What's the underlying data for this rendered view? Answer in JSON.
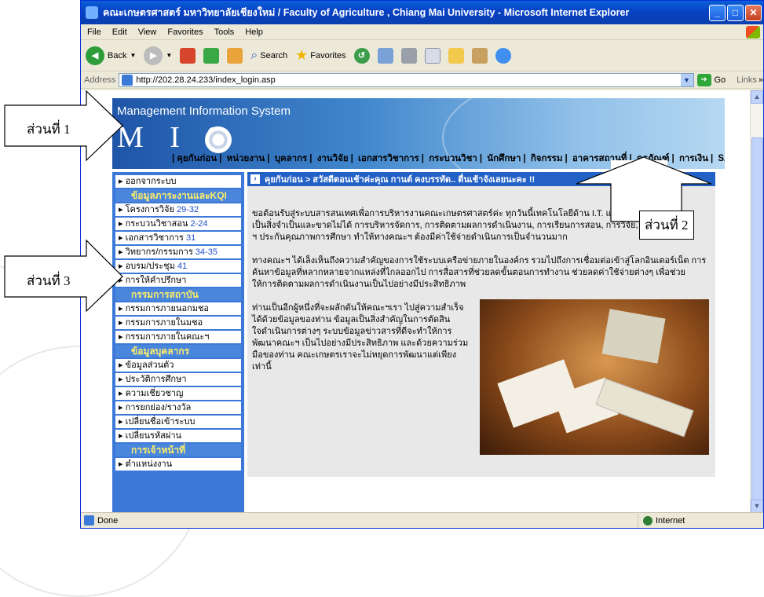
{
  "window": {
    "title": "คณะเกษตรศาสตร์ มหาวิทยาลัยเชียงใหม่ / Faculty of Agriculture , Chiang Mai University   - Microsoft Internet Explorer",
    "min_icon": "minimize-icon",
    "max_icon": "maximize-icon",
    "close_icon": "close-icon"
  },
  "menu": [
    "File",
    "Edit",
    "View",
    "Favorites",
    "Tools",
    "Help"
  ],
  "toolbar": {
    "back": "Back",
    "search": "Search",
    "favorites": "Favorites"
  },
  "address": {
    "label": "Address",
    "url": "http://202.28.24.233/index_login.asp",
    "go": "Go",
    "links": "Links"
  },
  "header": {
    "subtitle": "Management Information System",
    "logo": "M I S"
  },
  "topnav": [
    "คุยกันก่อน",
    "หน่วยงาน",
    "บุคลากร",
    "งานวิจัย",
    "เอกสารวิชาการ",
    "กระบวนวิชา",
    "นักศึกษา",
    "กิจกรรม",
    "อาคารสถานที่",
    "ครุภัณฑ์",
    "การเงิน",
    "SAR"
  ],
  "breadcrumb": "คุยกันก่อน > สวัสดีตอนเช้าค่ะคุณ กานต์ คงบรรทัด.. ตื่นเช้าจังเลยนะคะ !!",
  "sidebar": {
    "logout": "ออกจากระบบ",
    "section1": "ข้อมูลภาระงานและKQI",
    "items1": [
      {
        "label": "โครงการวิจัย",
        "num": "29-32"
      },
      {
        "label": "กระบวนวิชาสอน",
        "num": "2-24"
      },
      {
        "label": "เอกสารวิชาการ",
        "num": "31"
      },
      {
        "label": "วิทยากร/กรรมการ",
        "num": "34-35"
      },
      {
        "label": "อบรม/ประชุม",
        "num": "41"
      },
      {
        "label": "การให้คำปรึกษา",
        "num": ""
      }
    ],
    "section2": "กรรมการสถาบัน",
    "items2": [
      "กรรมการภายนอกมชอ",
      "กรรมการภายในมชอ",
      "กรรมการภายในคณะฯ"
    ],
    "section3": "ข้อมูลบุคลากร",
    "items3": [
      "ข้อมูลส่วนตัว",
      "ประวัติการศึกษา",
      "ความเชี่ยวชาญ",
      "การยกย่อง/รางวัล",
      "เปลี่ยนชื่อเข้าระบบ",
      "เปลี่ยนรหัสผ่าน"
    ],
    "section4": "การเจ้าหน้าที่",
    "items4": [
      "ตำแหน่งงาน"
    ]
  },
  "content": {
    "p1": "ขอต้อนรับสู่ระบบสารสนเทศเพื่อการบริหารงานคณะเกษตรศาสตร์ค่ะ ทุกวันนี้เทคโนโลยีด้าน I.T. และ กลายเป็นสิ่งจำเป็นและขาดไม่ได้ การบริหารจัดการ, การติดตามผลการดำเนินงาน, การเรียนการสอน, การวิจัย, ฯ ประกันคุณภาพการศึกษา ทำให้ทางคณะฯ ต้องมีค่าใช้จ่ายดำเนินการเป็นจำนวนมาก",
    "p2": "ทางคณะฯ ได้เล็งเห็นถึงความสำคัญของการใช้ระบบเครือข่ายภายในองค์กร รวมไปถึงการเชื่อมต่อเข้าสู่โลกอินเตอร์เน็ต การค้นหาข้อมูลที่หลากหลายจากแหล่งที่ไกลออกไป การสื่อสารที่ช่วยลดขั้นตอนการทำงาน ช่วยลดค่าใช้จ่ายต่างๆ เพื่อช่วยให้การติดตามผลการดำเนินงานเป็นไปอย่างมีประสิทธิภาพ",
    "p3": "ท่านเป็นอีกผู้หนึ่งที่จะผลักดันให้คณะฯเรา ไปสู่ความสำเร็จได้ด้วยข้อมูลของท่าน ข้อมูลเป็นสิ่งสำคัญในการตัดสินใจดำเนินการต่างๆ ระบบข้อมูลข่าวสารที่ดีจะทำให้การพัฒนาคณะฯ เป็นไปอย่างมีประสิทธิภาพ และด้วยความร่วมมือของท่าน คณะเกษตรเราจะไม่หยุดการพัฒนาแต่เพียงเท่านี้"
  },
  "status": {
    "left": "Done",
    "zone": "Internet"
  },
  "annotations": [
    "ส่วนที่ 1",
    "ส่วนที่ 2",
    "ส่วนที่ 3"
  ]
}
